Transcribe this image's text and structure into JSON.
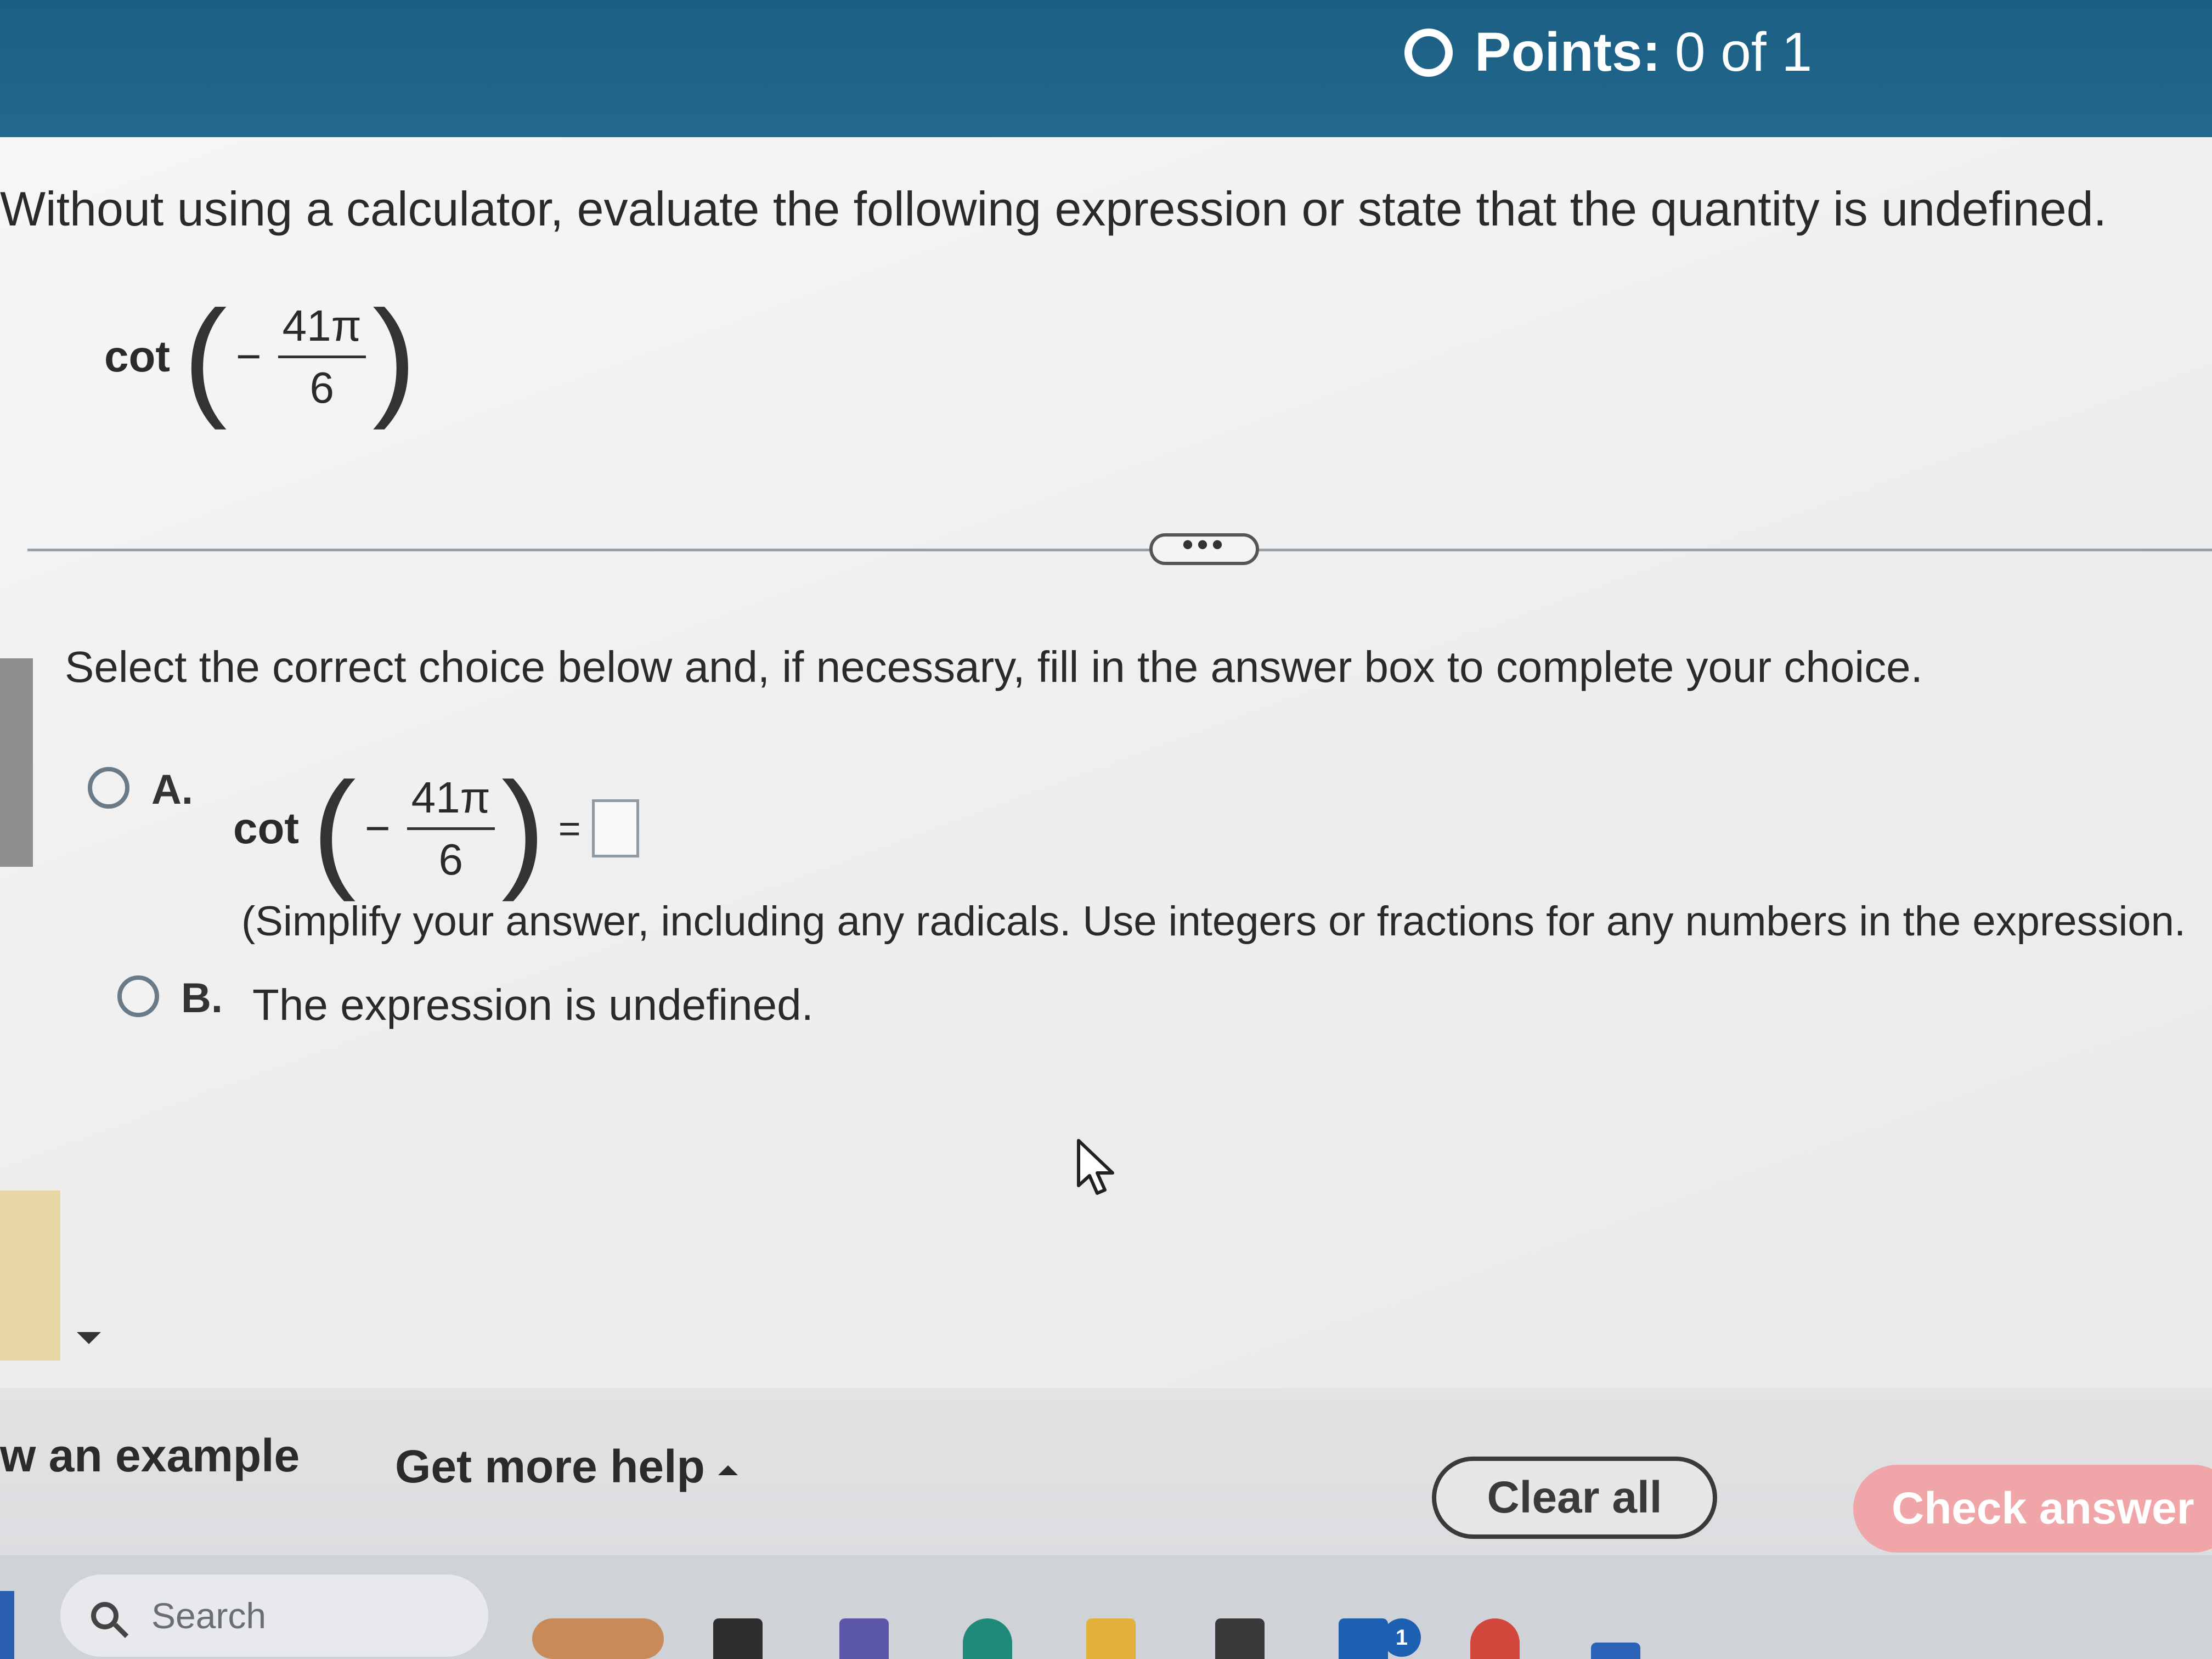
{
  "header": {
    "points_label": "Points:",
    "points_value": "0 of 1"
  },
  "question": {
    "prompt": "Without using a calculator, evaluate the following expression or state that the quantity is undefined.",
    "expression": {
      "function": "cot",
      "sign": "−",
      "numerator": "41π",
      "denominator": "6"
    },
    "more_button_label": "•••"
  },
  "answer": {
    "instruction": "Select the correct choice below and, if necessary, fill in the answer box to complete your choice.",
    "choices": [
      {
        "letter": "A.",
        "function": "cot",
        "sign": "−",
        "numerator": "41π",
        "denominator": "6",
        "equals": "=",
        "hint": "(Simplify your answer, including any radicals. Use integers or fractions for any numbers in the expression."
      },
      {
        "letter": "B.",
        "text": "The expression is undefined."
      }
    ]
  },
  "footer": {
    "example_link": "w an example",
    "help_link": "Get more help",
    "clear_button": "Clear all",
    "check_button": "Check answer"
  },
  "taskbar": {
    "search_placeholder": "Search",
    "badge_count": "1"
  }
}
